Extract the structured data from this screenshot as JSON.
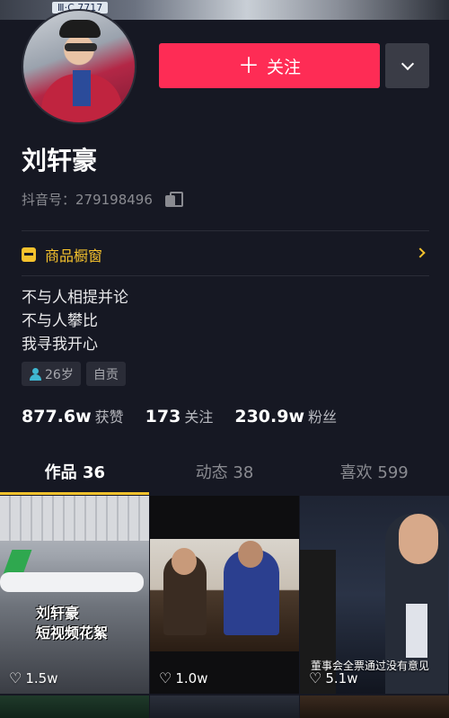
{
  "header": {
    "cover_plate_text": "Ⅲ·C 7717"
  },
  "profile": {
    "name": "刘轩豪",
    "douyin_id": "抖音号：279198496",
    "follow_label": "关注",
    "follow_color": "#fe2c55"
  },
  "shop": {
    "label": "商品橱窗",
    "accent": "#f5c22d"
  },
  "bio": {
    "lines": [
      "不与人相提并论",
      "不与人攀比",
      "我寻我开心"
    ]
  },
  "tags": [
    {
      "label": "26岁",
      "icon": "person-icon"
    },
    {
      "label": "自贡"
    }
  ],
  "stats": [
    {
      "value": "877.6w",
      "label": "获赞"
    },
    {
      "value": "173",
      "label": "关注"
    },
    {
      "value": "230.9w",
      "label": "粉丝"
    }
  ],
  "tabs": [
    {
      "label": "作品 36",
      "active": true
    },
    {
      "label": "动态 38",
      "active": false
    },
    {
      "label": "喜欢 599",
      "active": false
    }
  ],
  "videos": [
    {
      "likes": "1.5w",
      "overlay": [
        "刘轩豪",
        "短视频花絮"
      ]
    },
    {
      "likes": "1.0w"
    },
    {
      "likes": "5.1w",
      "subtitle": "董事会全票通过没有意见"
    }
  ]
}
